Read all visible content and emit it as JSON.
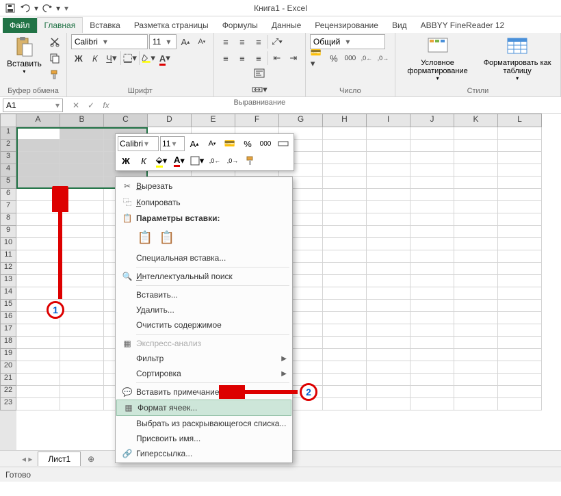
{
  "title": "Книга1 - Excel",
  "qat": {
    "save": "💾",
    "undo": "↶",
    "redo": "↷",
    "more": "▾"
  },
  "tabs": [
    "Файл",
    "Главная",
    "Вставка",
    "Разметка страницы",
    "Формулы",
    "Данные",
    "Рецензирование",
    "Вид",
    "ABBYY FineReader 12"
  ],
  "activeTab": 1,
  "ribbon": {
    "clipboard": {
      "label": "Буфер обмена",
      "paste": "Вставить"
    },
    "font": {
      "label": "Шрифт",
      "name": "Calibri",
      "size": "11",
      "bold": "Ж",
      "italic": "К",
      "underline": "Ч"
    },
    "align": {
      "label": "Выравнивание"
    },
    "number": {
      "label": "Число",
      "format": "Общий"
    },
    "styles": {
      "label": "Стили",
      "cond": "Условное форматирование",
      "table": "Форматировать как таблицу"
    }
  },
  "formula": {
    "namebox": "A1",
    "fx": "fx"
  },
  "columns": [
    "A",
    "B",
    "C",
    "D",
    "E",
    "F",
    "G",
    "H",
    "I",
    "J",
    "K",
    "L"
  ],
  "rows": [
    1,
    2,
    3,
    4,
    5,
    6,
    7,
    8,
    9,
    10,
    11,
    12,
    13,
    14,
    15,
    16,
    17,
    18,
    19,
    20,
    21,
    22,
    23
  ],
  "selectedCols": 3,
  "selectedRows": 5,
  "miniToolbar": {
    "font": "Calibri",
    "size": "11",
    "incFont": "A",
    "decFont": "A",
    "bold": "Ж",
    "italic": "К"
  },
  "contextMenu": {
    "cut": "Вырезать",
    "copy": "Копировать",
    "pasteHeader": "Параметры вставки:",
    "pasteSpecial": "Специальная вставка...",
    "smartLookup": "Интеллектуальный поиск",
    "insert": "Вставить...",
    "delete": "Удалить...",
    "clear": "Очистить содержимое",
    "quickAnalysis": "Экспресс-анализ",
    "filter": "Фильтр",
    "sort": "Сортировка",
    "insertComment": "Вставить примечание",
    "formatCells": "Формат ячеек...",
    "pickFromList": "Выбрать из раскрывающегося списка...",
    "defineName": "Присвоить имя...",
    "hyperlink": "Гиперссылка..."
  },
  "sheetTabs": {
    "sheet1": "Лист1"
  },
  "statusbar": {
    "ready": "Готово"
  },
  "annotations": {
    "badge1": "1",
    "badge2": "2"
  }
}
